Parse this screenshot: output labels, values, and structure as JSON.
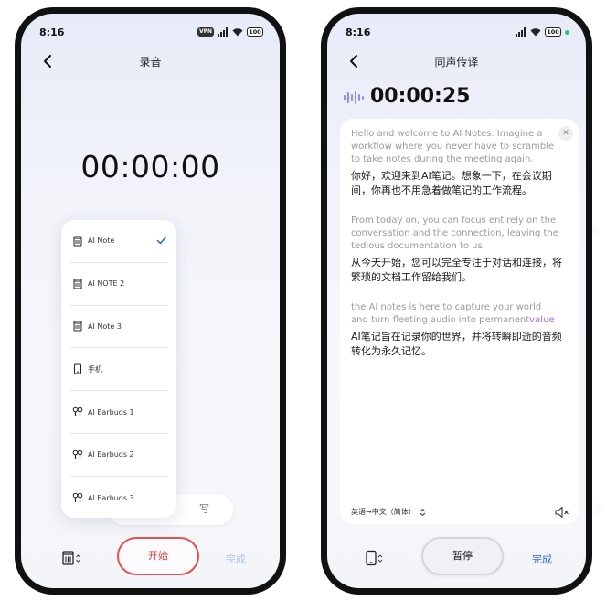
{
  "colors": {
    "accent": "#2a63d8",
    "record_red": "#e6504e",
    "highlight_purple": "#a36cf0"
  },
  "watermark_text": "录音笔记·6386",
  "left_screen": {
    "status": {
      "time": "8:16",
      "vpn": "VPN",
      "battery": "100"
    },
    "title": "录音",
    "timer": "00:00:00",
    "device_dropdown": {
      "selected_index": 0,
      "items": [
        {
          "label": "AI Note",
          "icon": "recorder-icon"
        },
        {
          "label": "AI NOTE 2",
          "icon": "recorder-icon"
        },
        {
          "label": "AI Note 3",
          "icon": "recorder-icon"
        },
        {
          "label": "手机",
          "icon": "phone-icon"
        },
        {
          "label": "AI Earbuds 1",
          "icon": "earbuds-icon"
        },
        {
          "label": "AI Earbuds 2",
          "icon": "earbuds-icon"
        },
        {
          "label": "AI Earbuds 3",
          "icon": "earbuds-icon"
        }
      ]
    },
    "hidden_button_partial": "写",
    "start_label": "开始",
    "finish_label": "完成"
  },
  "right_screen": {
    "status": {
      "time": "8:16",
      "battery": "100"
    },
    "title": "同声传译",
    "elapsed": "00:00:25",
    "paragraphs": [
      {
        "en": "Hello and welcome to AI Notes. Imagine a workflow where you never have to scramble to take notes during the meeting again.",
        "zh": "你好，欢迎来到AI笔记。想象一下，在会议期间，你再也不用急着做笔记的工作流程。"
      },
      {
        "en": "From today on, you can focus entirely on the conversation and the connection, leaving the tedious documentation to us.",
        "zh": "从今天开始，您可以完全专注于对话和连接，将繁琐的文档工作留给我们。"
      },
      {
        "en": "the AI notes is here to capture your world and turn fleeting audio into permanent",
        "en_highlight": "value",
        "zh": "AI笔记旨在记录你的世界，并将转瞬即逝的音频转化为永久记忆。"
      }
    ],
    "language_pair": "英语→中文（简体）",
    "pause_label": "暂停",
    "finish_label": "完成"
  }
}
